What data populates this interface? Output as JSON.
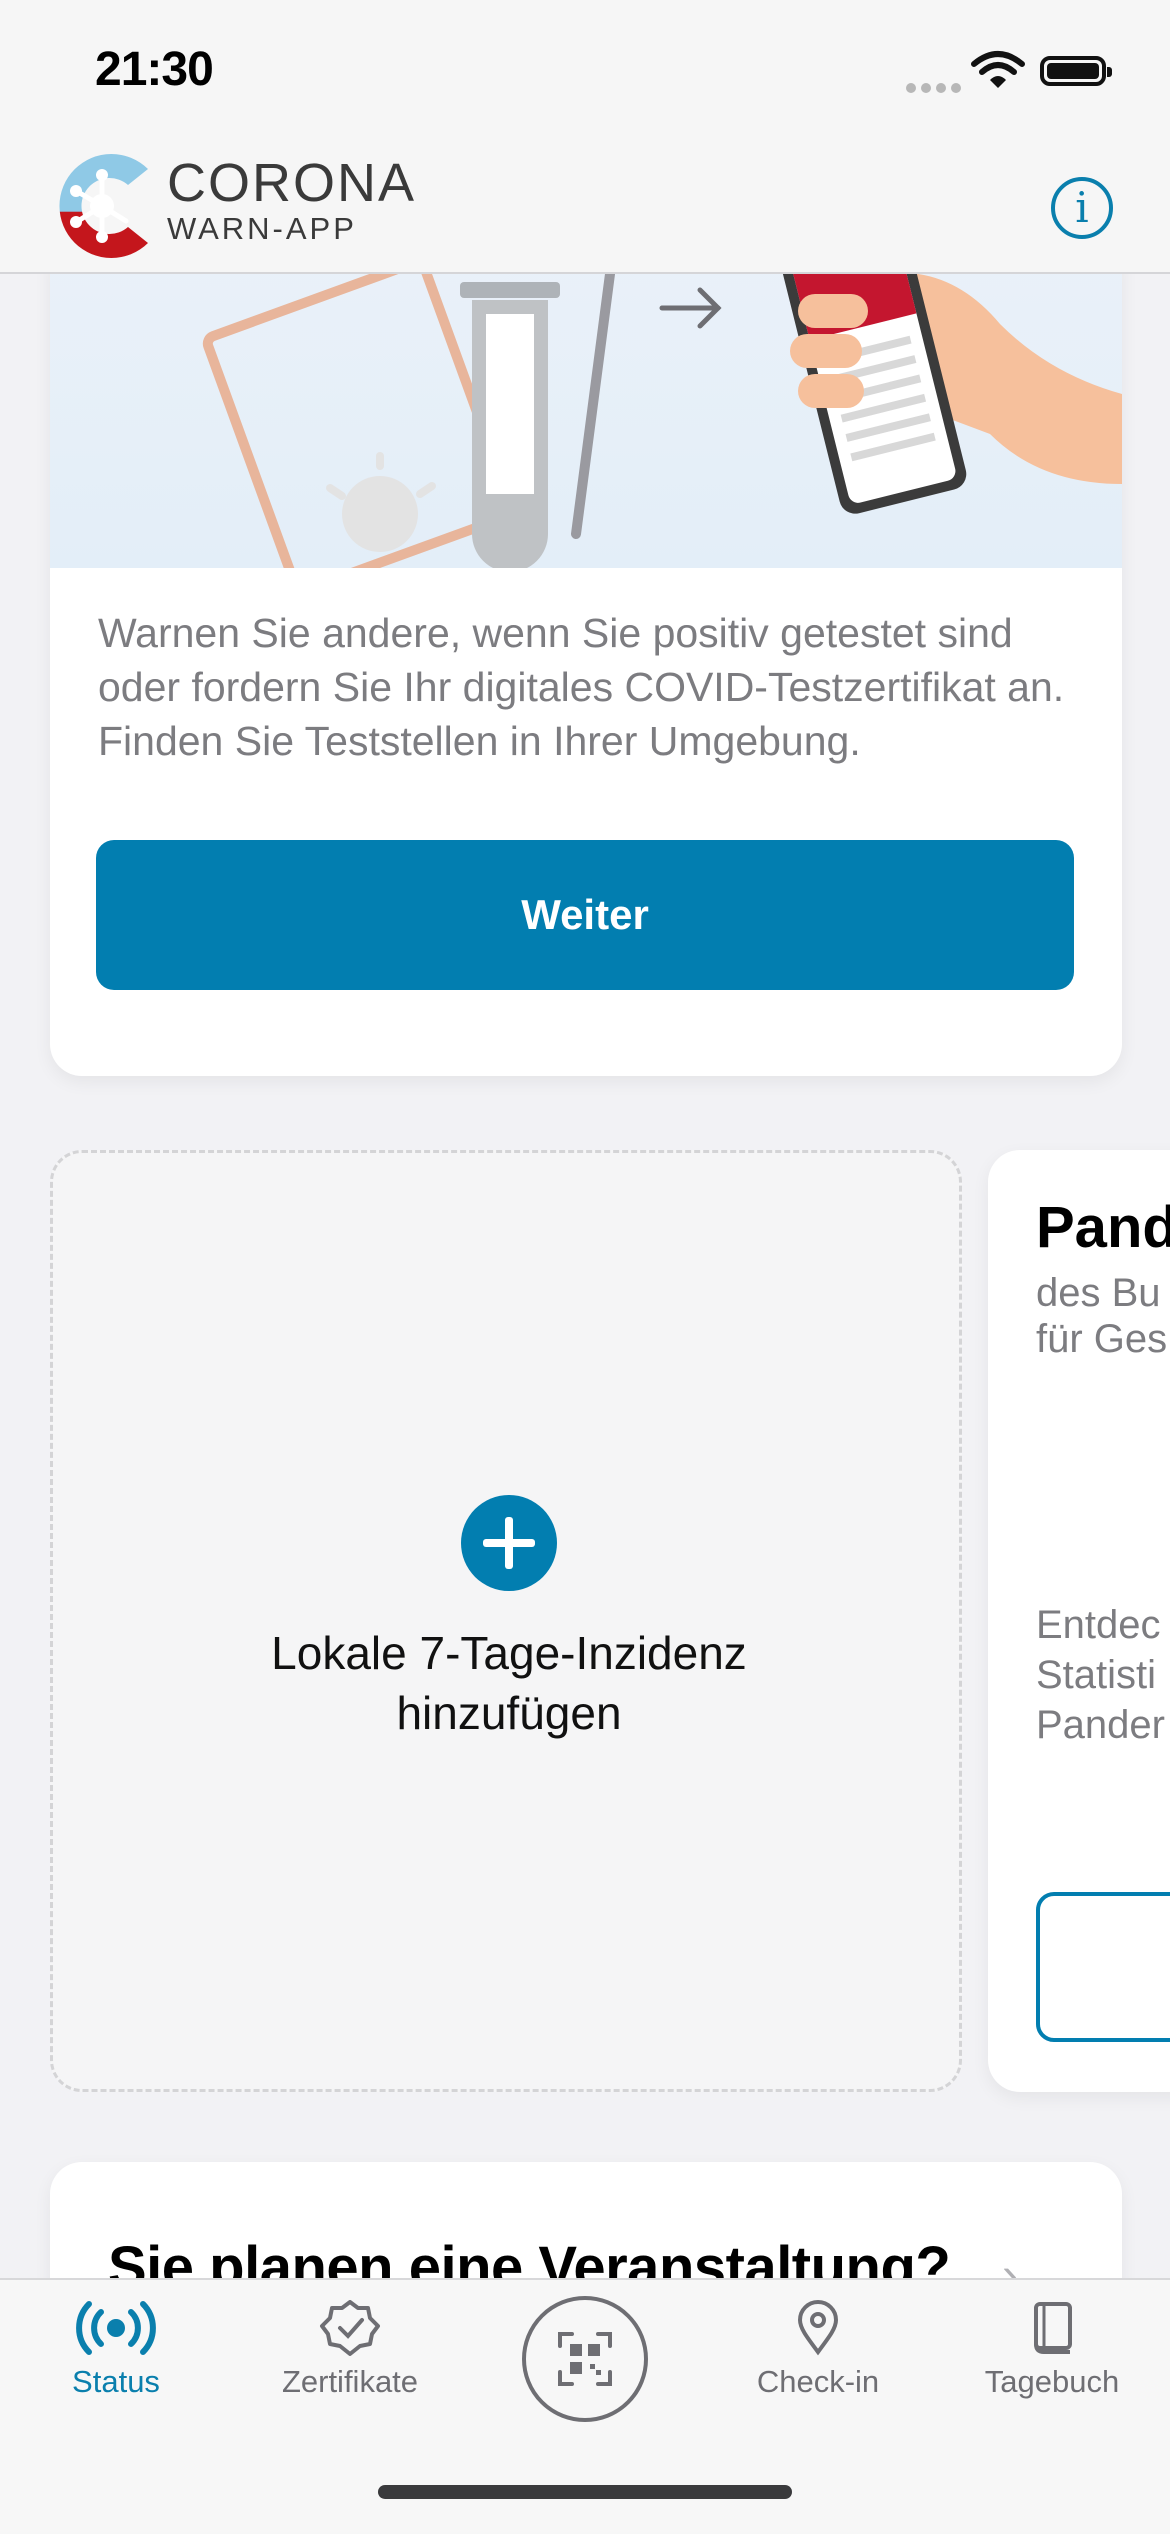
{
  "status_bar": {
    "time": "21:30"
  },
  "header": {
    "brand_main": "CORONA",
    "brand_sub": "WARN-APP",
    "info_label": "i"
  },
  "test_card": {
    "description": "Warnen Sie andere, wenn Sie positiv getestet sind oder fordern Sie Ihr digitales COVID-Testzertifikat an. Finden Sie Teststellen in Ihrer Umgebung.",
    "button_label": "Weiter"
  },
  "incidence_card": {
    "label": "Lokale 7-Tage-Inzidenz hinzufügen"
  },
  "stats_card": {
    "title": "Pand",
    "subtitle_line1": "des Bu",
    "subtitle_line2": "für Ges",
    "desc_line1": "Entdec",
    "desc_line2": "Statisti",
    "desc_line3": "Pander"
  },
  "event_card": {
    "title": "Sie planen eine Veranstaltung?"
  },
  "tab_bar": {
    "tabs": [
      {
        "label": "Status",
        "icon": "status-icon",
        "active": true
      },
      {
        "label": "Zertifikate",
        "icon": "certificate-icon",
        "active": false
      },
      {
        "label": "",
        "icon": "qr-scan-icon",
        "active": false
      },
      {
        "label": "Check-in",
        "icon": "location-pin-icon",
        "active": false
      },
      {
        "label": "Tagebuch",
        "icon": "diary-book-icon",
        "active": false
      }
    ]
  },
  "colors": {
    "accent": "#027eb0",
    "brand_red": "#c4161c"
  }
}
